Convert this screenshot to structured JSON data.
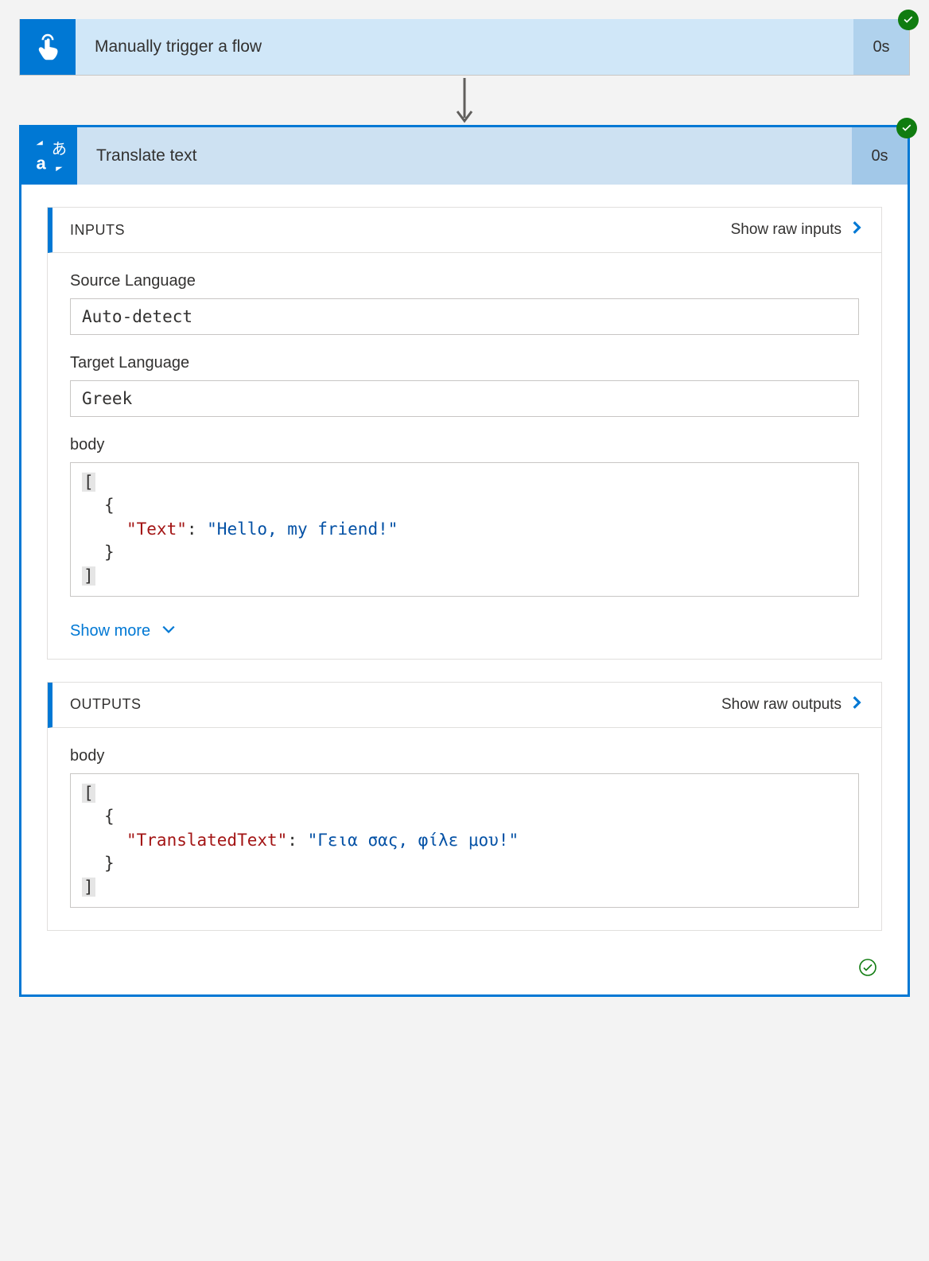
{
  "trigger": {
    "title": "Manually trigger a flow",
    "duration": "0s"
  },
  "action": {
    "title": "Translate text",
    "duration": "0s",
    "inputs": {
      "section_label": "INPUTS",
      "raw_link": "Show raw inputs",
      "fields": {
        "source_lang_label": "Source Language",
        "source_lang_value": "Auto-detect",
        "target_lang_label": "Target Language",
        "target_lang_value": "Greek",
        "body_label": "body",
        "body_code": {
          "key": "\"Text\"",
          "value": "\"Hello, my friend!\""
        }
      },
      "show_more": "Show more"
    },
    "outputs": {
      "section_label": "OUTPUTS",
      "raw_link": "Show raw outputs",
      "fields": {
        "body_label": "body",
        "body_code": {
          "key": "\"TranslatedText\"",
          "value": "\"Γεια σας, φίλε μου!\""
        }
      }
    }
  }
}
